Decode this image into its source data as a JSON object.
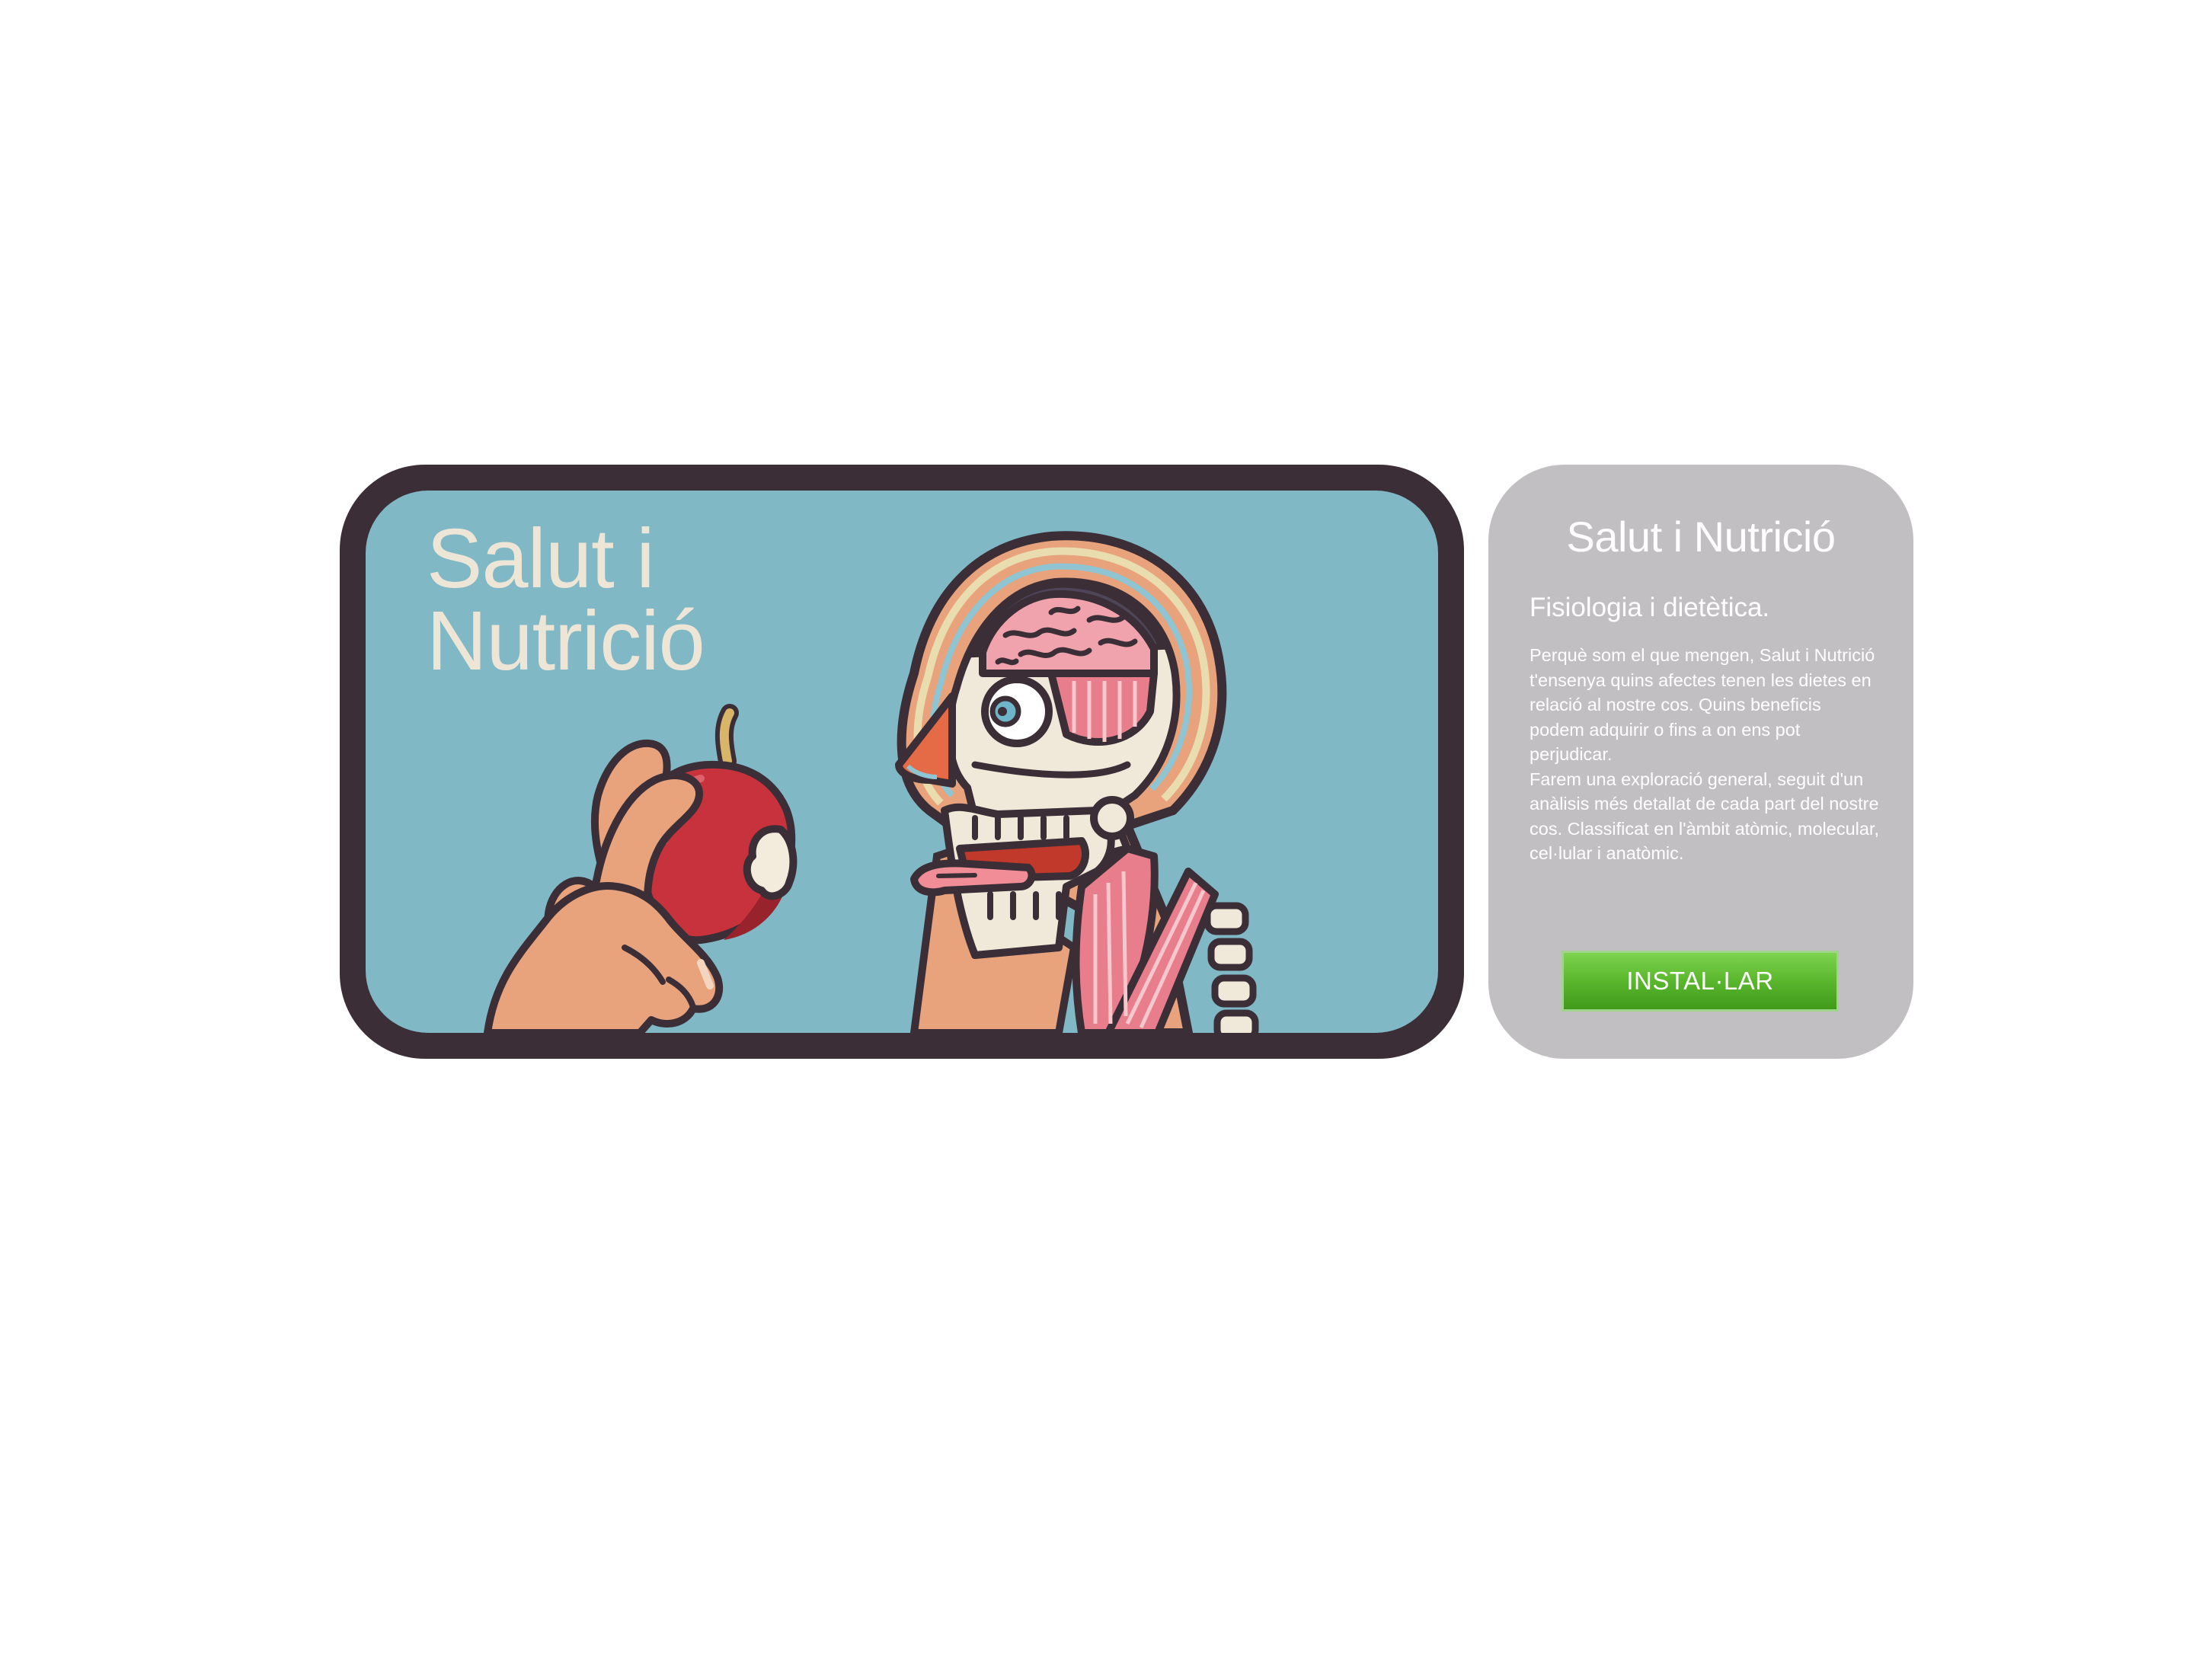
{
  "banner": {
    "title_line1": "Salut i",
    "title_line2": "Nutrició"
  },
  "info": {
    "title": "Salut i Nutrició",
    "subtitle": "Fisiologia i dietètica.",
    "description_p1": "Perquè som el que mengen, Salut i Nutrició t'ensenya quins afectes tenen les dietes en relació al nostre cos. Quins beneficis podem adquirir o fins a on ens pot perjudicar.",
    "description_p2": "Farem una exploració general, seguit d'un anàlisis més detallat de cada part del nostre cos. Classificat en l'àmbit atòmic, molecular, cel·lular i anatòmic.",
    "install_label": "INSTAL·LAR"
  },
  "colors": {
    "banner_frame": "#3b2e36",
    "banner_background": "#80b8c6",
    "banner_title": "#ede6d6",
    "info_card": "#c2bfc2",
    "install_button": "#5bb82e"
  },
  "icons": {
    "illustration": "anatomical-head-eating-apple",
    "apple": "apple-icon",
    "hand": "hand-icon",
    "brain": "brain-icon"
  }
}
